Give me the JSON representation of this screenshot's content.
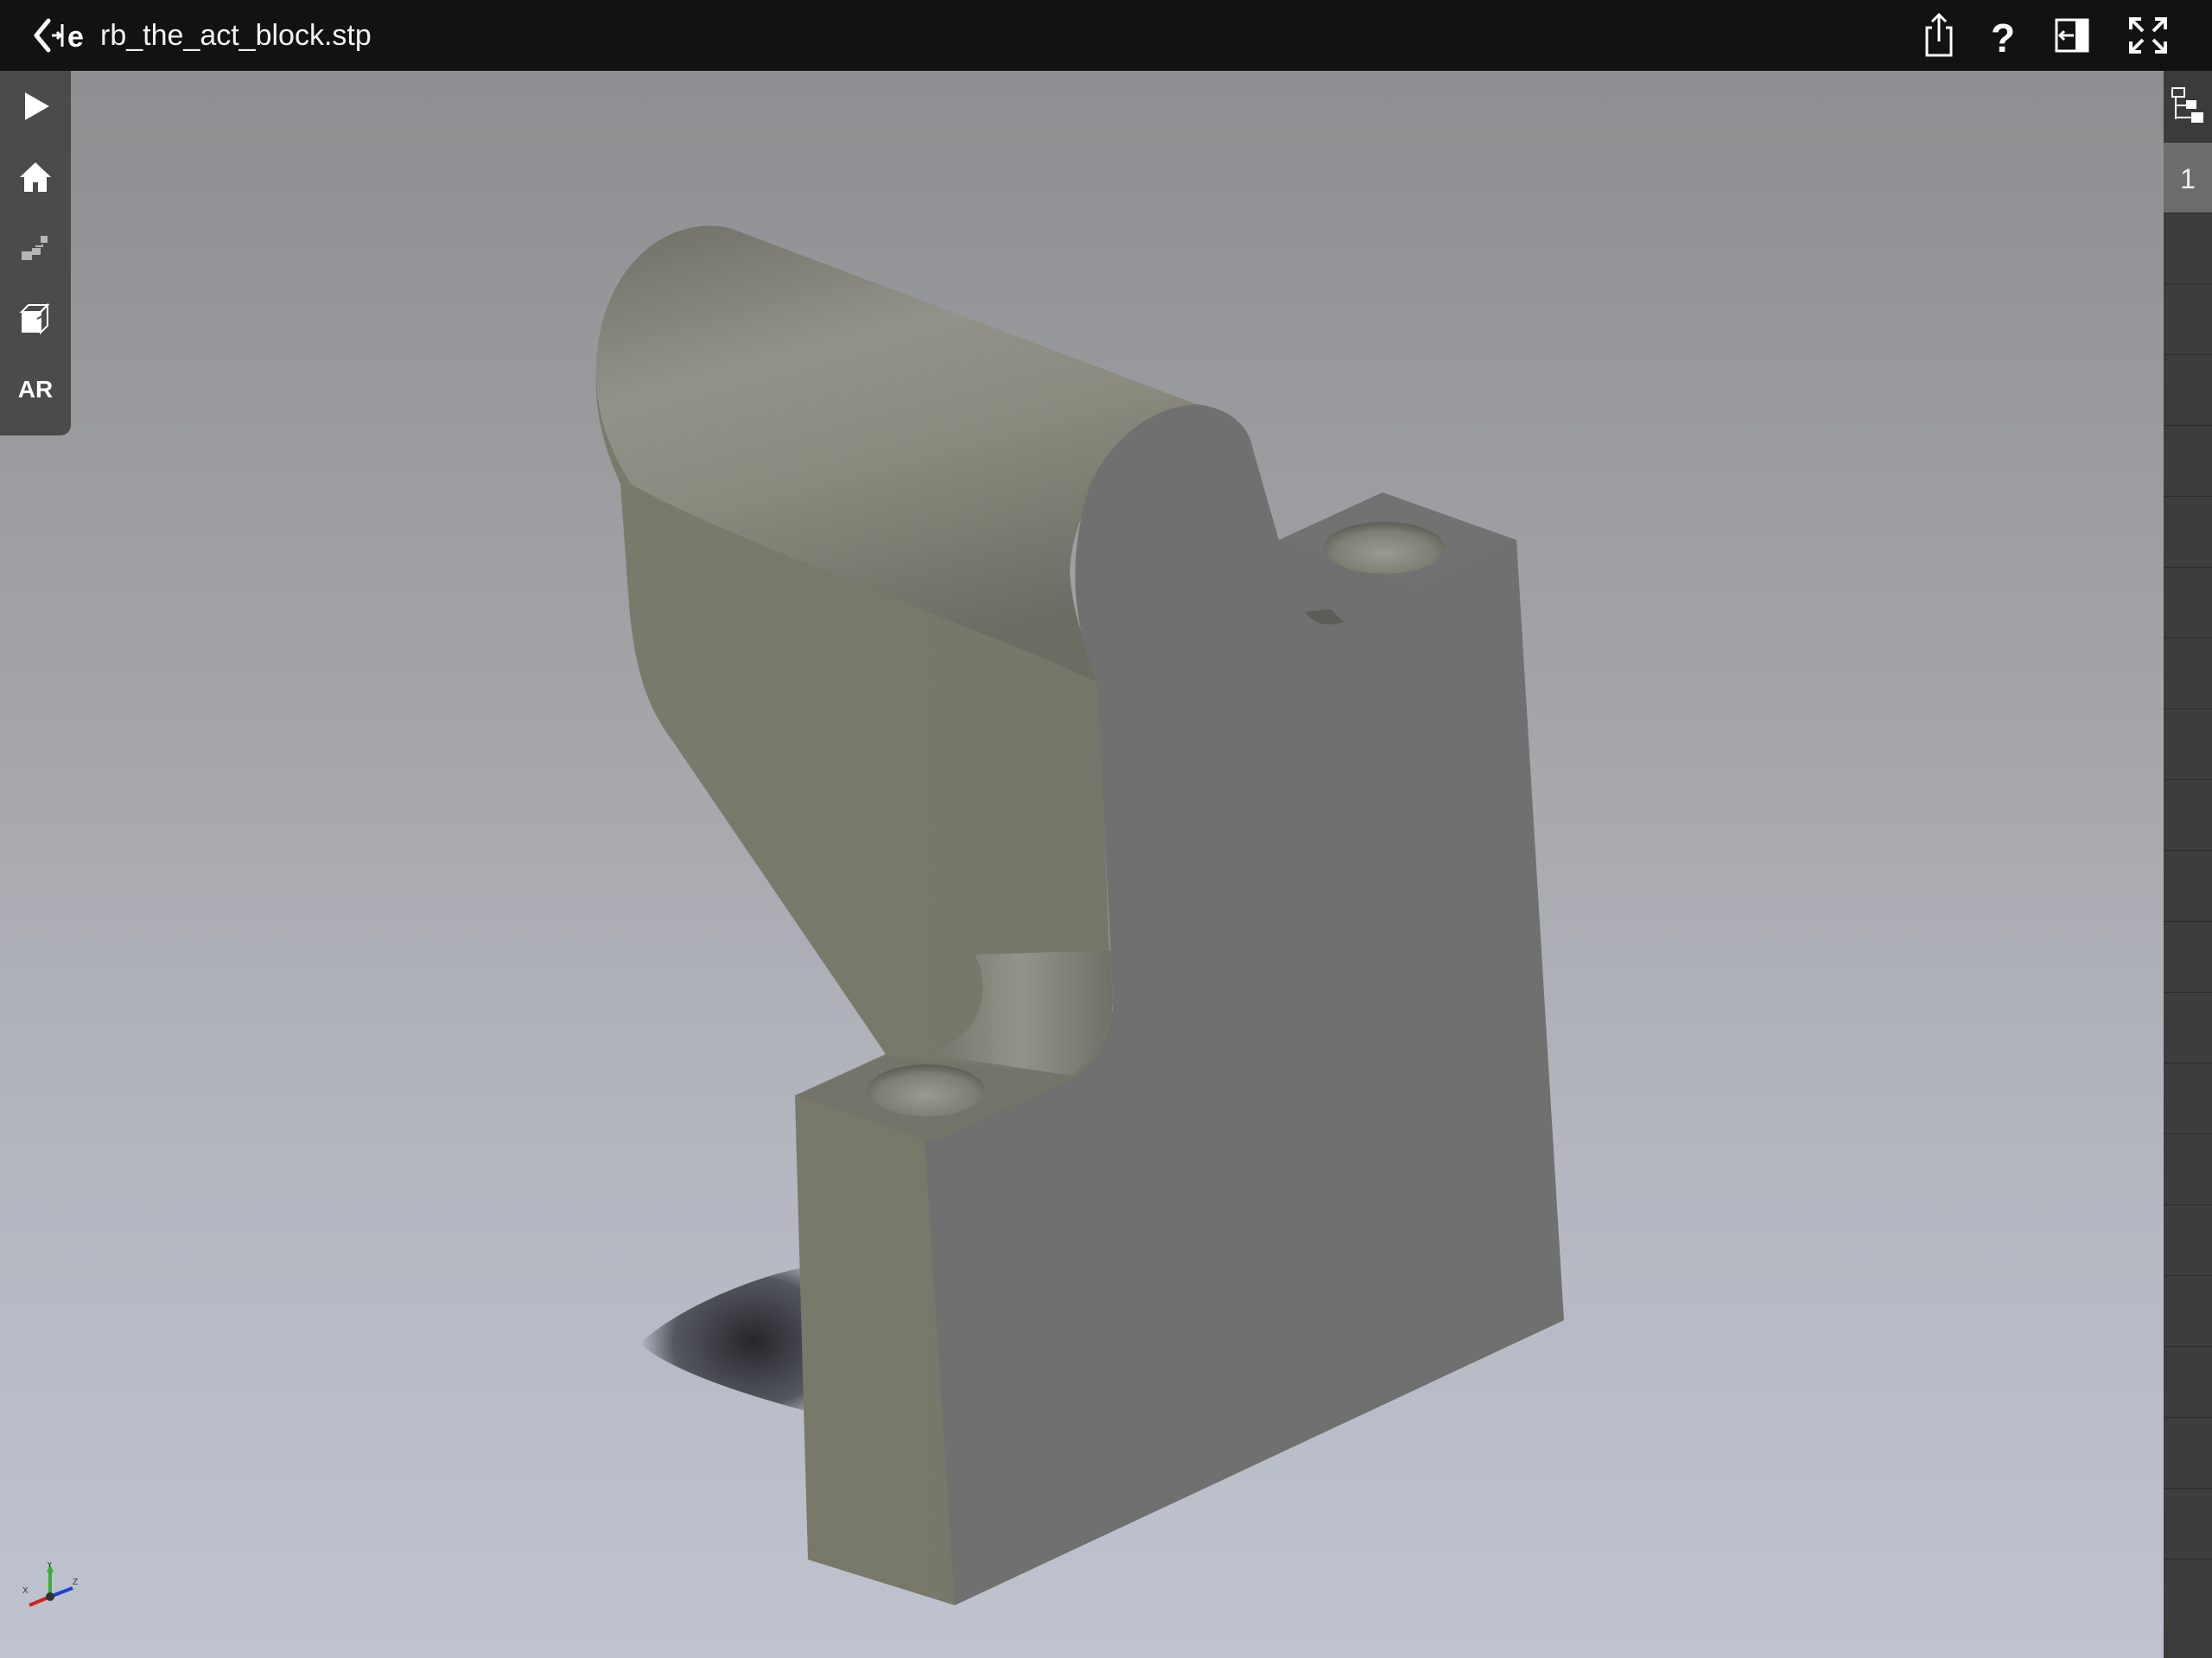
{
  "header": {
    "title": "rb_the_act_block.stp"
  },
  "left_toolbar": {
    "ar_label": "AR"
  },
  "right_panel": {
    "items": [
      {
        "label": "1"
      }
    ]
  },
  "icons": {
    "back": "back-chevron-icon",
    "logo": "app-logo-icon",
    "share": "share-icon",
    "help": "help-icon",
    "panel": "collapse-panel-icon",
    "fullscreen": "fullscreen-icon",
    "play": "play-icon",
    "home": "home-icon",
    "explode": "explode-view-icon",
    "section": "section-cube-icon",
    "tree": "structure-tree-icon",
    "axes": "axis-triad-icon"
  },
  "colors": {
    "topbar": "#121212",
    "toolbar": "#4b4b4b",
    "model_face": "#707070",
    "model_side": "#777768"
  }
}
